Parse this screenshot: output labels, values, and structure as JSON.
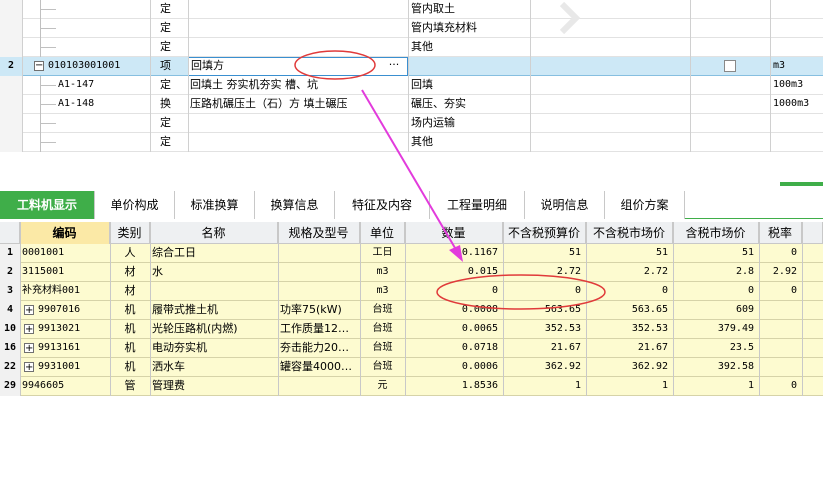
{
  "top_grid": {
    "rows": [
      {
        "num": "",
        "code": "",
        "type": "定",
        "name": "",
        "content": "管内取土",
        "unit": ""
      },
      {
        "num": "",
        "code": "",
        "type": "定",
        "name": "",
        "content": "管内填充材料",
        "unit": ""
      },
      {
        "num": "",
        "code": "",
        "type": "定",
        "name": "",
        "content": "其他",
        "unit": ""
      },
      {
        "num": "2",
        "code": "010103001001",
        "type": "项",
        "name": "回填方",
        "content": "",
        "unit": "m3",
        "selected": true
      },
      {
        "num": "",
        "code": "A1-147",
        "type": "定",
        "name": "回填土 夯实机夯实 槽、坑",
        "content": "回填",
        "unit": "100m3"
      },
      {
        "num": "",
        "code": "A1-148",
        "type": "换",
        "name": "压路机碾压土（石）方 填土碾压",
        "content": "碾压、夯实",
        "unit": "1000m3"
      },
      {
        "num": "",
        "code": "",
        "type": "定",
        "name": "",
        "content": "场内运输",
        "unit": ""
      },
      {
        "num": "",
        "code": "",
        "type": "定",
        "name": "",
        "content": "其他",
        "unit": ""
      }
    ],
    "ellipsis": "···",
    "expand_symbol": "−"
  },
  "tabs": [
    {
      "label": "工料机显示",
      "active": true
    },
    {
      "label": "单价构成"
    },
    {
      "label": "标准换算"
    },
    {
      "label": "换算信息"
    },
    {
      "label": "特征及内容"
    },
    {
      "label": "工程量明细"
    },
    {
      "label": "说明信息"
    },
    {
      "label": "组价方案"
    }
  ],
  "bottom_grid": {
    "headers": [
      "编码",
      "类别",
      "名称",
      "规格及型号",
      "单位",
      "数量",
      "不含税预算价",
      "不含税市场价",
      "含税市场价",
      "税率"
    ],
    "rows": [
      {
        "num": "1",
        "expand": false,
        "code": "0001001",
        "cat": "人",
        "name": "综合工日",
        "spec": "",
        "unit": "工日",
        "qty": "0.1167",
        "budget": "51",
        "market": "51",
        "tax_market": "51",
        "rate": "0"
      },
      {
        "num": "2",
        "expand": false,
        "code": "3115001",
        "cat": "材",
        "name": "水",
        "spec": "",
        "unit": "m3",
        "qty": "0.015",
        "budget": "2.72",
        "market": "2.72",
        "tax_market": "2.8",
        "rate": "2.92"
      },
      {
        "num": "3",
        "expand": false,
        "code": "补充材料001",
        "cat": "材",
        "name": "",
        "spec": "",
        "unit": "m3",
        "qty": "0",
        "budget": "0",
        "market": "0",
        "tax_market": "0",
        "rate": "0"
      },
      {
        "num": "4",
        "expand": true,
        "code": "9907016",
        "cat": "机",
        "name": "履带式推土机",
        "spec": "功率75(kW)",
        "unit": "台班",
        "qty": "0.0008",
        "budget": "563.65",
        "market": "563.65",
        "tax_market": "609",
        "rate": ""
      },
      {
        "num": "10",
        "expand": true,
        "code": "9913021",
        "cat": "机",
        "name": "光轮压路机(内燃)",
        "spec": "工作质量12…",
        "unit": "台班",
        "qty": "0.0065",
        "budget": "352.53",
        "market": "352.53",
        "tax_market": "379.49",
        "rate": ""
      },
      {
        "num": "16",
        "expand": true,
        "code": "9913161",
        "cat": "机",
        "name": "电动夯实机",
        "spec": "夯击能力20…",
        "unit": "台班",
        "qty": "0.0718",
        "budget": "21.67",
        "market": "21.67",
        "tax_market": "23.5",
        "rate": ""
      },
      {
        "num": "22",
        "expand": true,
        "code": "9931001",
        "cat": "机",
        "name": "洒水车",
        "spec": "罐容量4000…",
        "unit": "台班",
        "qty": "0.0006",
        "budget": "362.92",
        "market": "362.92",
        "tax_market": "392.58",
        "rate": ""
      },
      {
        "num": "29",
        "expand": false,
        "code": "9946605",
        "cat": "管",
        "name": "管理费",
        "spec": "",
        "unit": "元",
        "qty": "1.8536",
        "budget": "1",
        "market": "1",
        "tax_market": "1",
        "rate": "0"
      }
    ]
  },
  "colors": {
    "active_tab": "#3fae49",
    "selected_row": "#cde8f6",
    "row_yellow": "#fdfbd0",
    "annotation": "#e03a3a",
    "arrow": "#e23bdc"
  }
}
